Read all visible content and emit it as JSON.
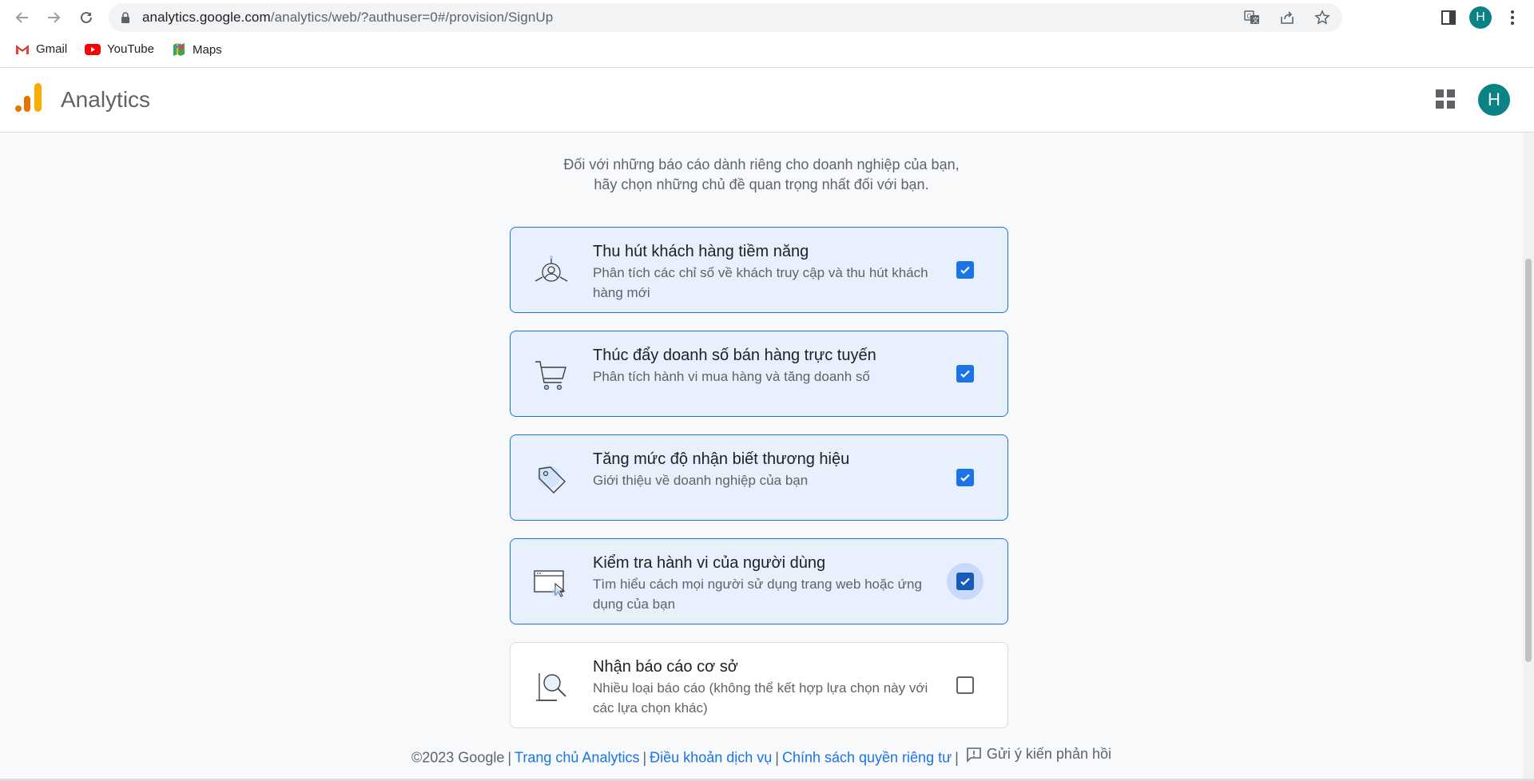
{
  "browser": {
    "url_host": "analytics.google.com",
    "url_path": "/analytics/web/?authuser=0#/provision/SignUp",
    "profile_initial": "H",
    "bookmarks": [
      {
        "label": "Gmail",
        "icon": "gmail-icon"
      },
      {
        "label": "YouTube",
        "icon": "youtube-icon"
      },
      {
        "label": "Maps",
        "icon": "maps-icon"
      }
    ]
  },
  "header": {
    "app_name": "Analytics",
    "account_initial": "H",
    "accent": "#f9ab00",
    "avatar_color": "#0b8385"
  },
  "intro": {
    "line1": "Đối với những báo cáo dành riêng cho doanh nghiệp của bạn,",
    "line2": "hãy chọn những chủ đề quan trọng nhất đối với bạn."
  },
  "options": [
    {
      "title": "Thu hút khách hàng tiềm năng",
      "desc_line1": "Phân tích các chỉ số về khách truy cập và thu hút khách",
      "desc_line2": "hàng mới",
      "checked": true,
      "icon": "audience-target-icon"
    },
    {
      "title": "Thúc đẩy doanh số bán hàng trực tuyến",
      "desc_line1": "Phân tích hành vi mua hàng và tăng doanh số",
      "desc_line2": "",
      "checked": true,
      "icon": "shopping-cart-icon"
    },
    {
      "title": "Tăng mức độ nhận biết thương hiệu",
      "desc_line1": "Giới thiệu về doanh nghiệp của bạn",
      "desc_line2": "",
      "checked": true,
      "icon": "tag-icon"
    },
    {
      "title": "Kiểm tra hành vi của người dùng",
      "desc_line1": "Tìm hiểu cách mọi người sử dụng trang web hoặc ứng",
      "desc_line2": "dụng của bạn",
      "checked": true,
      "icon": "browser-cursor-icon"
    },
    {
      "title": "Nhận báo cáo cơ sở",
      "desc_line1": "Nhiều loại báo cáo (không thể kết hợp lựa chọn này với",
      "desc_line2": "các lựa chọn khác)",
      "checked": false,
      "icon": "magnifier-report-icon"
    }
  ],
  "footer": {
    "copyright": "©2023 Google",
    "link_home": "Trang chủ Analytics",
    "link_terms": "Điều khoản dịch vụ",
    "link_privacy": "Chính sách quyền riêng tư",
    "feedback": "Gửi ý kiến phản hồi"
  }
}
